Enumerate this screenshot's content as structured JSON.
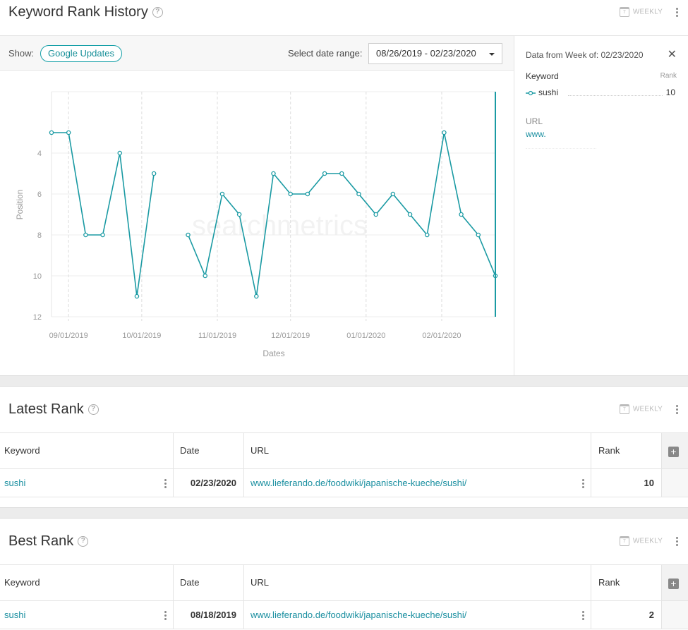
{
  "history": {
    "title": "Keyword Rank History",
    "help_glyph": "?",
    "weekly_label": "WEEKLY",
    "show_label": "Show:",
    "google_updates_label": "Google Updates",
    "date_range_label": "Select date range:",
    "date_range_value": "08/26/2019 - 02/23/2020",
    "watermark": "searchmetrics",
    "side_panel": {
      "title": "Data from Week of: 02/23/2020",
      "close_glyph": "✕",
      "keyword_header": "Keyword",
      "rank_header": "Rank",
      "keyword": "sushi",
      "rank": "10",
      "url_header": "URL",
      "url_value": "www."
    }
  },
  "chart_data": {
    "type": "line",
    "xlabel": "Dates",
    "ylabel": "Position",
    "y_reversed": true,
    "ylim": [
      1,
      12
    ],
    "y_ticks": [
      4,
      6,
      8,
      10,
      12
    ],
    "x_ticks": [
      "09/01/2019",
      "10/01/2019",
      "11/01/2019",
      "12/01/2019",
      "01/01/2020",
      "02/01/2020"
    ],
    "grid": true,
    "series": [
      {
        "name": "sushi",
        "color": "#1a9aa3",
        "points": [
          [
            "08/25/2019",
            3
          ],
          [
            "09/01/2019",
            3
          ],
          [
            "09/08/2019",
            8
          ],
          [
            "09/15/2019",
            8
          ],
          [
            "09/22/2019",
            4
          ],
          [
            "09/29/2019",
            11
          ],
          [
            "10/06/2019",
            5
          ],
          [
            "10/13/2019",
            null
          ],
          [
            "10/20/2019",
            8
          ],
          [
            "10/27/2019",
            10
          ],
          [
            "11/03/2019",
            6
          ],
          [
            "11/10/2019",
            7
          ],
          [
            "11/17/2019",
            11
          ],
          [
            "11/24/2019",
            5
          ],
          [
            "12/01/2019",
            6
          ],
          [
            "12/08/2019",
            6
          ],
          [
            "12/15/2019",
            5
          ],
          [
            "12/22/2019",
            5
          ],
          [
            "12/29/2019",
            6
          ],
          [
            "01/05/2020",
            7
          ],
          [
            "01/12/2020",
            6
          ],
          [
            "01/19/2020",
            7
          ],
          [
            "01/26/2020",
            8
          ],
          [
            "02/02/2020",
            3
          ],
          [
            "02/09/2020",
            7
          ],
          [
            "02/16/2020",
            8
          ],
          [
            "02/23/2020",
            10
          ]
        ]
      }
    ]
  },
  "latest": {
    "title": "Latest Rank",
    "help_glyph": "?",
    "weekly_label": "WEEKLY",
    "headers": {
      "keyword": "Keyword",
      "date": "Date",
      "url": "URL",
      "rank": "Rank",
      "add": "+"
    },
    "row": {
      "keyword": "sushi",
      "date": "02/23/2020",
      "url": "www.lieferando.de/foodwiki/japanische-kueche/sushi/",
      "rank": "10"
    }
  },
  "best": {
    "title": "Best Rank",
    "help_glyph": "?",
    "weekly_label": "WEEKLY",
    "headers": {
      "keyword": "Keyword",
      "date": "Date",
      "url": "URL",
      "rank": "Rank",
      "add": "+"
    },
    "row": {
      "keyword": "sushi",
      "date": "08/18/2019",
      "url": "www.lieferando.de/foodwiki/japanische-kueche/sushi/",
      "rank": "2"
    }
  }
}
